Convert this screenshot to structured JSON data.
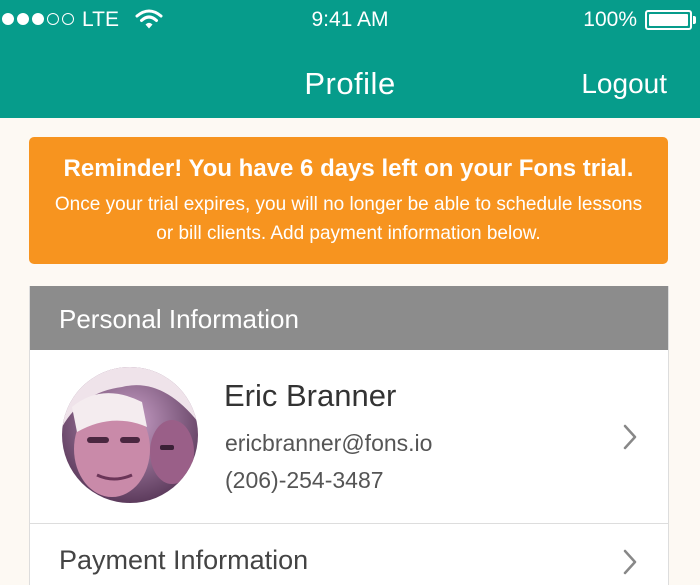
{
  "status_bar": {
    "carrier": "LTE",
    "time": "9:41 AM",
    "battery": "100%",
    "signal_bars_filled": 3,
    "signal_bars_total": 5
  },
  "nav": {
    "title": "Profile",
    "logout_label": "Logout"
  },
  "banner": {
    "title": "Reminder! You have 6 days left on your Fons trial.",
    "body": "Once your trial expires, you will no longer be able to schedule lessons or bill clients. Add payment information below."
  },
  "personal": {
    "header": "Personal Information",
    "name": "Eric Branner",
    "email": "ericbranner@fons.io",
    "phone": "(206)-254-3487"
  },
  "payment": {
    "label": "Payment Information"
  },
  "colors": {
    "header_bg": "#069c8b",
    "banner_bg": "#f7941f",
    "section_header_bg": "#8c8c8c"
  },
  "icons": [
    "wifi-icon",
    "battery-icon",
    "chevron-right-icon",
    "avatar-photo"
  ]
}
